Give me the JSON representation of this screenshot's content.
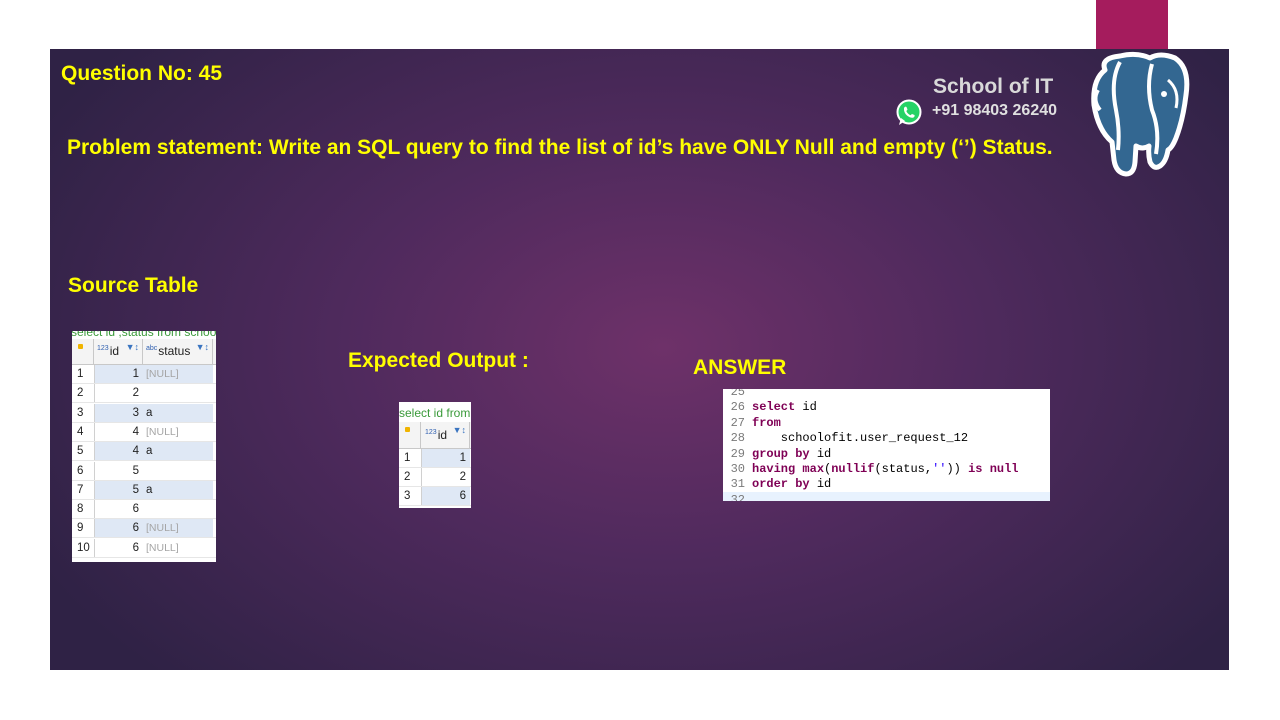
{
  "question": "Question No: 45",
  "problem": "Problem statement: Write an SQL query to find the list of id’s have ONLY Null and empty (‘’) Status.",
  "brand": {
    "name": "School of IT",
    "phone": "+91 98403 26240"
  },
  "source_title": "Source Table",
  "expected_title": "Expected  Output :",
  "answer_title": "ANSWER",
  "source_grid": {
    "caption": "select id ,status from schoo",
    "columns": [
      "id",
      "status"
    ],
    "col_prefix": {
      "id": "123",
      "status": "abc"
    },
    "rows": [
      {
        "n": "1",
        "id": "1",
        "status": "[NULL]"
      },
      {
        "n": "2",
        "id": "2",
        "status": ""
      },
      {
        "n": "3",
        "id": "3",
        "status": "a"
      },
      {
        "n": "4",
        "id": "4",
        "status": "[NULL]"
      },
      {
        "n": "5",
        "id": "4",
        "status": "a"
      },
      {
        "n": "6",
        "id": "5",
        "status": ""
      },
      {
        "n": "7",
        "id": "5",
        "status": "a"
      },
      {
        "n": "8",
        "id": "6",
        "status": ""
      },
      {
        "n": "9",
        "id": "6",
        "status": "[NULL]"
      },
      {
        "n": "10",
        "id": "6",
        "status": "[NULL]"
      }
    ]
  },
  "output_grid": {
    "caption": "select id from",
    "columns": [
      "id"
    ],
    "col_prefix": {
      "id": "123"
    },
    "rows": [
      {
        "n": "1",
        "id": "1"
      },
      {
        "n": "2",
        "id": "2"
      },
      {
        "n": "3",
        "id": "6"
      }
    ]
  },
  "code": {
    "lines": [
      {
        "n": "25",
        "text": ""
      },
      {
        "n": "26",
        "text": "select id"
      },
      {
        "n": "27",
        "text": "from"
      },
      {
        "n": "28",
        "text": "    schoolofit.user_request_12"
      },
      {
        "n": "29",
        "text": "group by id"
      },
      {
        "n": "30",
        "text": "having max(nullif(status,'')) is null"
      },
      {
        "n": "31",
        "text": "order by id"
      },
      {
        "n": "32",
        "text": ""
      }
    ]
  },
  "colors": {
    "accent_text": "#ffff00",
    "slide_bg": "#4f2a5d",
    "pink_bar": "#a51c5d",
    "whatsapp": "#25d366"
  },
  "icons": {
    "brand": "whatsapp-icon",
    "logo": "postgresql-elephant-logo"
  }
}
